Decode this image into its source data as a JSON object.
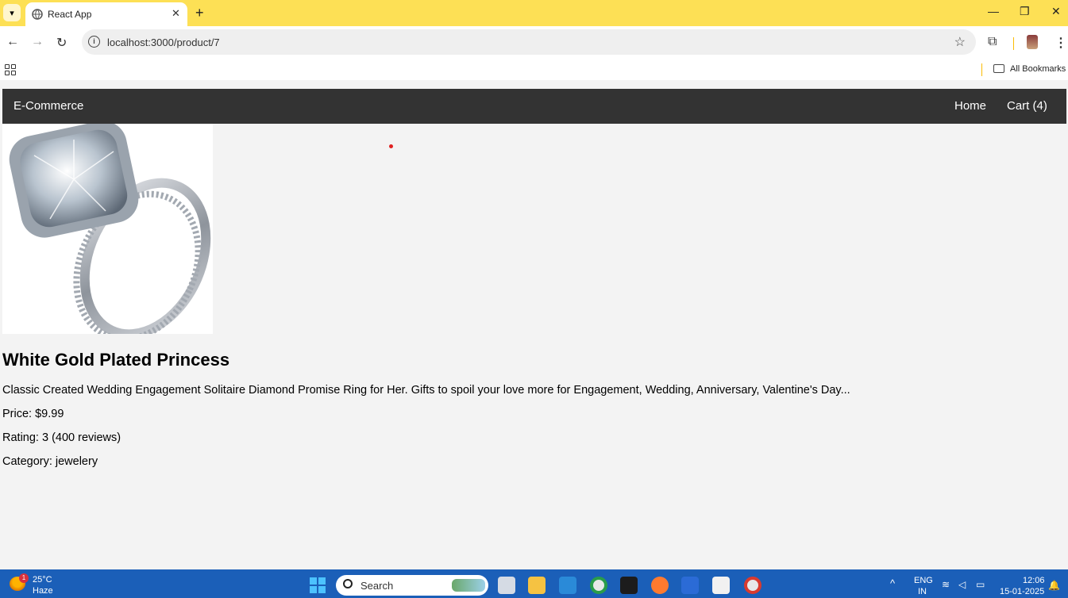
{
  "browser": {
    "tab_title": "React App",
    "url": "localhost:3000/product/7",
    "bookmarks_label": "All Bookmarks"
  },
  "navbar": {
    "brand": "E-Commerce",
    "home": "Home",
    "cart": "Cart (4)"
  },
  "product": {
    "title": "White Gold Plated Princess",
    "description": "Classic Created Wedding Engagement Solitaire Diamond Promise Ring for Her. Gifts to spoil your love more for Engagement, Wedding, Anniversary, Valentine's Day...",
    "price": "Price: $9.99",
    "rating": "Rating: 3 (400 reviews)",
    "category": "Category: jewelery"
  },
  "taskbar": {
    "weather_badge": "1",
    "temperature": "25°C",
    "condition": "Haze",
    "search_placeholder": "Search",
    "language": "ENG",
    "region": "IN",
    "time": "12:06",
    "date": "15-01-2025"
  },
  "colors": {
    "tabbar": "#fde055",
    "navbar": "#333333",
    "page_bg": "#f3f3f3",
    "taskbar": "#1b5fb8"
  }
}
